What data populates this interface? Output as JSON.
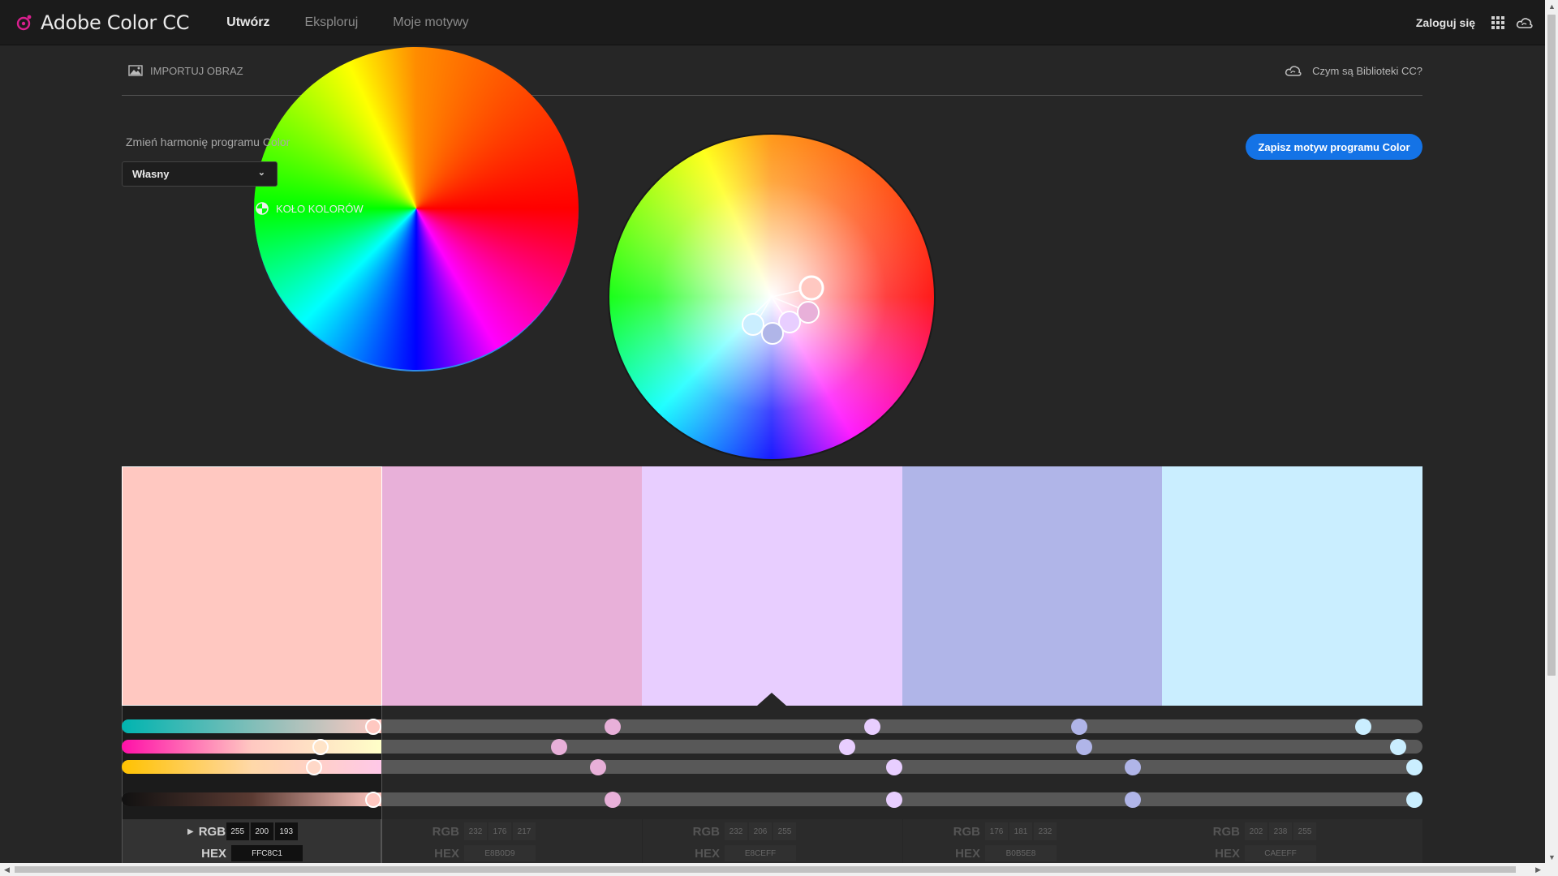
{
  "app": {
    "title": "Adobe Color CC"
  },
  "nav": {
    "items": [
      {
        "label": "Utwórz"
      },
      {
        "label": "Eksploruj"
      },
      {
        "label": "Moje motywy"
      }
    ]
  },
  "header": {
    "login": "Zaloguj się"
  },
  "tabs": {
    "import": "IMPORTUJ OBRAZ",
    "wheel": "KOŁO KOLORÓW"
  },
  "cc_link": "Czym są Biblioteki CC?",
  "harmony": {
    "label": "Zmień harmonię programu Color",
    "value": "Własny"
  },
  "save_button": "Zapisz motyw programu Color",
  "swatches": [
    {
      "hex": "#FFC8C1",
      "rgb": [
        "255",
        "200",
        "193"
      ],
      "hex_label": "FFC8C1",
      "selected": true
    },
    {
      "hex": "#E8B0D9",
      "rgb": [
        "232",
        "176",
        "217"
      ],
      "hex_label": "E8B0D9",
      "selected": false
    },
    {
      "hex": "#E8CEFF",
      "rgb": [
        "232",
        "206",
        "255"
      ],
      "hex_label": "E8CEFF",
      "selected": false
    },
    {
      "hex": "#B0B5E8",
      "rgb": [
        "176",
        "181",
        "232"
      ],
      "hex_label": "B0B5E8",
      "selected": false
    },
    {
      "hex": "#CAEEFF",
      "rgb": [
        "202",
        "238",
        "255"
      ],
      "hex_label": "CAEEFF",
      "selected": false
    }
  ],
  "labels": {
    "rgb": "RGB",
    "hex": "HEX"
  },
  "colors": {
    "accent": "#1473e6",
    "tab_underline": "#2d8ceb",
    "background": "#262626",
    "topbar": "#1b1b1b"
  }
}
